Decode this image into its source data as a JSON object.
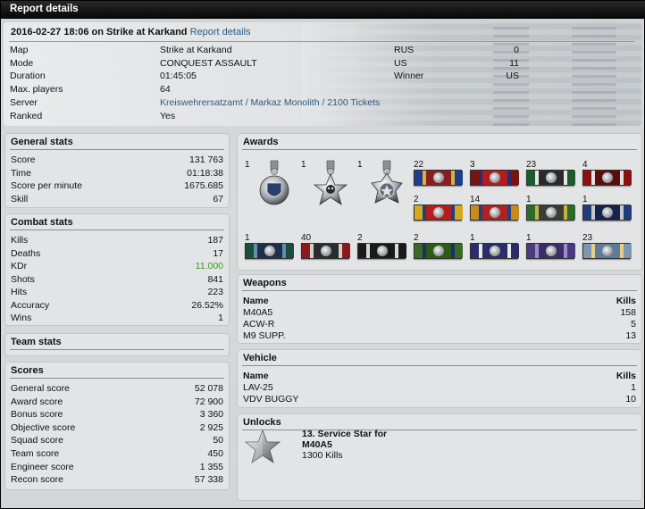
{
  "window": {
    "title": "Report details"
  },
  "header": {
    "date": "2016-02-27 18:06",
    "on_text": "on",
    "map_name": "Strike at Karkand",
    "link": "Report details",
    "rows": [
      {
        "label": "Map",
        "value": "Strike at Karkand"
      },
      {
        "label": "Mode",
        "value": "CONQUEST ASSAULT"
      },
      {
        "label": "Duration",
        "value": "01:45:05"
      },
      {
        "label": "Max. players",
        "value": "64"
      },
      {
        "label": "Server",
        "value": "Kreiswehrersatzamt / Markaz Monolith / 2100 Tickets"
      },
      {
        "label": "Ranked",
        "value": "Yes"
      }
    ],
    "teams": [
      {
        "label": "RUS",
        "value": "0"
      },
      {
        "label": "US",
        "value": "11"
      },
      {
        "label": "Winner",
        "value": "US"
      }
    ]
  },
  "general_stats": {
    "title": "General stats",
    "rows": [
      {
        "label": "Score",
        "value": "131 763"
      },
      {
        "label": "Time",
        "value": "01:18:38"
      },
      {
        "label": "Score per minute",
        "value": "1675.685"
      },
      {
        "label": "Skill",
        "value": "67"
      }
    ]
  },
  "combat_stats": {
    "title": "Combat stats",
    "rows": [
      {
        "label": "Kills",
        "value": "187"
      },
      {
        "label": "Deaths",
        "value": "17"
      },
      {
        "label": "KDr",
        "value": "11.000"
      },
      {
        "label": "Shots",
        "value": "841"
      },
      {
        "label": "Hits",
        "value": "223"
      },
      {
        "label": "Accuracy",
        "value": "26.52%"
      },
      {
        "label": "Wins",
        "value": "1"
      }
    ],
    "kdr_color": "#3a9a1e"
  },
  "team_stats": {
    "title": "Team stats"
  },
  "scores": {
    "title": "Scores",
    "rows": [
      {
        "label": "General score",
        "value": "52 078"
      },
      {
        "label": "Award score",
        "value": "72 900"
      },
      {
        "label": "Bonus score",
        "value": "3 360"
      },
      {
        "label": "Objective score",
        "value": "2 925"
      },
      {
        "label": "Squad score",
        "value": "50"
      },
      {
        "label": "Team score",
        "value": "450"
      },
      {
        "label": "Engineer score",
        "value": "1 355"
      },
      {
        "label": "Recon score",
        "value": "57 338"
      }
    ]
  },
  "awards": {
    "title": "Awards",
    "medals": [
      {
        "count": "1",
        "icon": "medal-shield-icon"
      },
      {
        "count": "1",
        "icon": "medal-skull-icon"
      },
      {
        "count": "1",
        "icon": "medal-star-icon"
      }
    ],
    "ribbons": [
      {
        "count": "22",
        "icon": "ribbon-icon",
        "colors": [
          "#1e3d8a",
          "#d7b23a",
          "#8a1e1e"
        ]
      },
      {
        "count": "3",
        "icon": "ribbon-icon",
        "colors": [
          "#7a1212",
          "#2b2b6e",
          "#b31c1c"
        ]
      },
      {
        "count": "23",
        "icon": "ribbon-icon",
        "colors": [
          "#1f5a2e",
          "#e6e6e6",
          "#2a2a2a"
        ]
      },
      {
        "count": "4",
        "icon": "ribbon-icon",
        "colors": [
          "#8c1010",
          "#e0e0e0",
          "#5a0d0d"
        ]
      },
      {
        "count": "2",
        "icon": "ribbon-icon",
        "colors": [
          "#d4a91e",
          "#1d3f8e",
          "#b81c1c"
        ]
      },
      {
        "count": "14",
        "icon": "ribbon-icon",
        "colors": [
          "#c98a1b",
          "#21427f",
          "#b41f1f"
        ]
      },
      {
        "count": "1",
        "icon": "ribbon-icon",
        "colors": [
          "#2a6b2e",
          "#c9b23a",
          "#3b3b3b"
        ]
      },
      {
        "count": "1",
        "icon": "ribbon-icon",
        "colors": [
          "#203c7c",
          "#c8c8c8",
          "#15244f"
        ]
      },
      {
        "count": "1",
        "icon": "ribbon-icon",
        "colors": [
          "#1b4e3a",
          "#5c8fb0",
          "#1e2f4a"
        ]
      },
      {
        "count": "40",
        "icon": "ribbon-icon",
        "colors": [
          "#8c1a1a",
          "#cfcfcf",
          "#2c2c2c"
        ]
      },
      {
        "count": "2",
        "icon": "ribbon-icon",
        "colors": [
          "#1a1a1a",
          "#d8d8d8",
          "#1a1a1a"
        ]
      },
      {
        "count": "2",
        "icon": "ribbon-icon",
        "colors": [
          "#3b6b22",
          "#1e2e66",
          "#2c5a18"
        ]
      },
      {
        "count": "1",
        "icon": "ribbon-icon",
        "colors": [
          "#2c2c6b",
          "#e9e9e9",
          "#2c2c6b"
        ]
      },
      {
        "count": "1",
        "icon": "ribbon-icon",
        "colors": [
          "#4b3a80",
          "#9b8cc9",
          "#3a2e66"
        ]
      },
      {
        "count": "23",
        "icon": "ribbon-icon",
        "colors": [
          "#7f96b0",
          "#e6cf8a",
          "#5f7b9a"
        ]
      }
    ]
  },
  "weapons": {
    "title": "Weapons",
    "col_name": "Name",
    "col_kills": "Kills",
    "rows": [
      {
        "name": "M40A5",
        "kills": "158"
      },
      {
        "name": "ACW-R",
        "kills": "5"
      },
      {
        "name": "M9 SUPP.",
        "kills": "13"
      }
    ]
  },
  "vehicle": {
    "title": "Vehicle",
    "col_name": "Name",
    "col_kills": "Kills",
    "rows": [
      {
        "name": "LAV-25",
        "kills": "1"
      },
      {
        "name": "VDV BUGGY",
        "kills": "10"
      }
    ]
  },
  "unlocks": {
    "title": "Unlocks",
    "item_title_1": "13. Service Star for",
    "item_title_2": "M40A5",
    "item_detail": "1300 Kills",
    "icon": "service-star-icon"
  },
  "colors": {
    "link": "#2b5b86",
    "topbar": "#0a0a0a"
  }
}
